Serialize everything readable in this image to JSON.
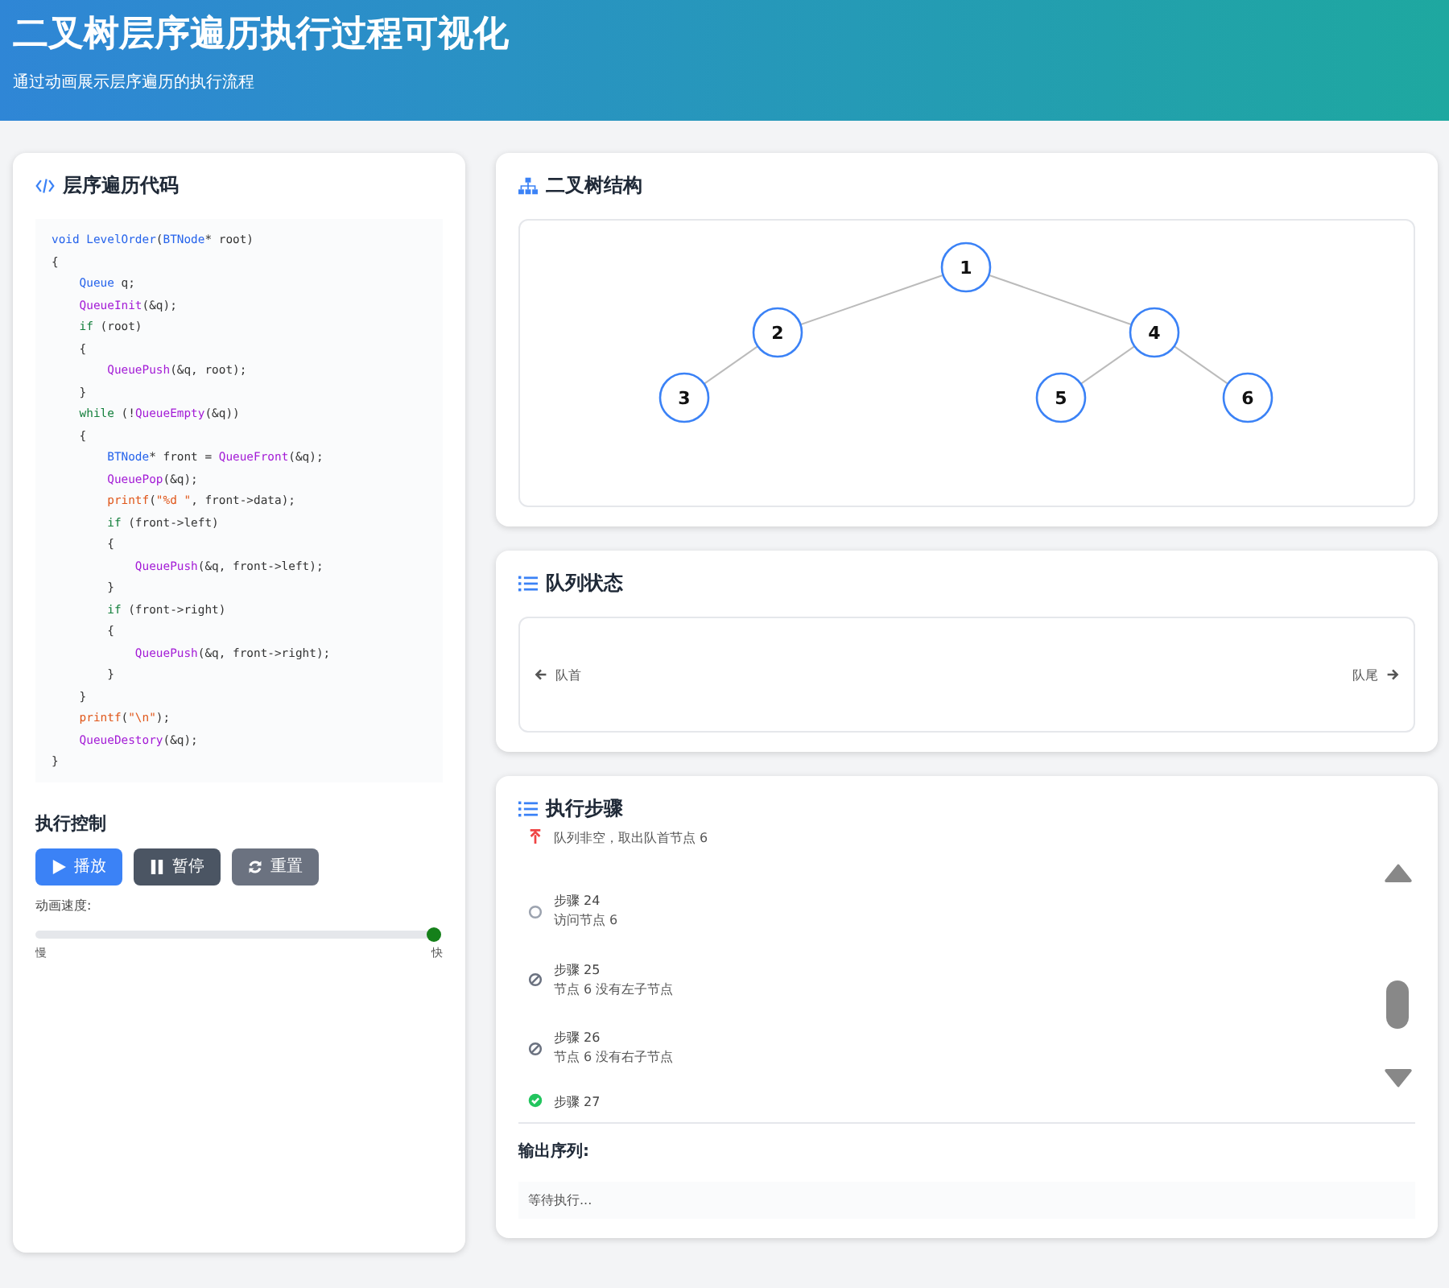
{
  "header": {
    "title": "二叉树层序遍历执行过程可视化",
    "subtitle": "通过动画展示层序遍历的执行流程"
  },
  "code_panel": {
    "title": "层序遍历代码",
    "lines": [
      [
        {
          "kind": "type",
          "text": "void "
        },
        {
          "kind": "type",
          "text": "LevelOrder"
        },
        {
          "kind": "plain",
          "text": "("
        },
        {
          "kind": "type",
          "text": "BTNode"
        },
        {
          "kind": "plain",
          "text": "* root)"
        }
      ],
      [
        {
          "kind": "plain",
          "text": "{"
        }
      ],
      [
        {
          "kind": "type",
          "text": "    Queue"
        },
        {
          "kind": "plain",
          "text": " q;"
        }
      ],
      [
        {
          "kind": "func",
          "text": "    QueueInit"
        },
        {
          "kind": "plain",
          "text": "(&q);"
        }
      ],
      [
        {
          "kind": "keyword",
          "text": "    if"
        },
        {
          "kind": "plain",
          "text": " (root)"
        }
      ],
      [
        {
          "kind": "plain",
          "text": "    {"
        }
      ],
      [
        {
          "kind": "func",
          "text": "        QueuePush"
        },
        {
          "kind": "plain",
          "text": "(&q, root);"
        }
      ],
      [
        {
          "kind": "plain",
          "text": "    }"
        }
      ],
      [
        {
          "kind": "keyword",
          "text": "    while"
        },
        {
          "kind": "plain",
          "text": " (!"
        },
        {
          "kind": "func",
          "text": "QueueEmpty"
        },
        {
          "kind": "plain",
          "text": "(&q))"
        }
      ],
      [
        {
          "kind": "plain",
          "text": "    {"
        }
      ],
      [
        {
          "kind": "type",
          "text": "        BTNode"
        },
        {
          "kind": "plain",
          "text": "* front = "
        },
        {
          "kind": "func",
          "text": "QueueFront"
        },
        {
          "kind": "plain",
          "text": "(&q);"
        }
      ],
      [
        {
          "kind": "func",
          "text": "        QueuePop"
        },
        {
          "kind": "plain",
          "text": "(&q);"
        }
      ],
      [
        {
          "kind": "io",
          "text": "        printf"
        },
        {
          "kind": "plain",
          "text": "("
        },
        {
          "kind": "io",
          "text": "\"%d \""
        },
        {
          "kind": "plain",
          "text": ", front->data);"
        }
      ],
      [
        {
          "kind": "keyword",
          "text": "        if"
        },
        {
          "kind": "plain",
          "text": " (front->left)"
        }
      ],
      [
        {
          "kind": "plain",
          "text": "        {"
        }
      ],
      [
        {
          "kind": "func",
          "text": "            QueuePush"
        },
        {
          "kind": "plain",
          "text": "(&q, front->left);"
        }
      ],
      [
        {
          "kind": "plain",
          "text": "        }"
        }
      ],
      [
        {
          "kind": "keyword",
          "text": "        if"
        },
        {
          "kind": "plain",
          "text": " (front->right)"
        }
      ],
      [
        {
          "kind": "plain",
          "text": "        {"
        }
      ],
      [
        {
          "kind": "func",
          "text": "            QueuePush"
        },
        {
          "kind": "plain",
          "text": "(&q, front->right);"
        }
      ],
      [
        {
          "kind": "plain",
          "text": "        }"
        }
      ],
      [
        {
          "kind": "plain",
          "text": "    }"
        }
      ],
      [
        {
          "kind": "io",
          "text": "    printf"
        },
        {
          "kind": "plain",
          "text": "("
        },
        {
          "kind": "io",
          "text": "\"\\n\""
        },
        {
          "kind": "plain",
          "text": ");"
        }
      ],
      [
        {
          "kind": "func",
          "text": "    QueueDestory"
        },
        {
          "kind": "plain",
          "text": "(&q);"
        }
      ],
      [
        {
          "kind": "plain",
          "text": "}"
        }
      ]
    ]
  },
  "controls": {
    "title": "执行控制",
    "buttons": [
      {
        "kind": "play",
        "label": "播放"
      },
      {
        "kind": "pause",
        "label": "暂停"
      },
      {
        "kind": "reset",
        "label": "重置"
      }
    ],
    "speed_label": "动画速度:",
    "speed": {
      "level": 1.0,
      "min_label": "慢",
      "max_label": "快"
    }
  },
  "tree_panel": {
    "title": "二叉树结构",
    "root": {
      "label": "1",
      "children": [
        {
          "label": "2",
          "kind": "left_child",
          "children": [
            {
              "label": "3",
              "kind": "left_child"
            }
          ]
        },
        {
          "label": "4",
          "kind": "right_child",
          "children": [
            {
              "label": "5",
              "kind": "left_child"
            },
            {
              "label": "6",
              "kind": "right_child"
            }
          ]
        }
      ]
    }
  },
  "queue_panel": {
    "title": "队列状态",
    "front_label": "队首",
    "rear_label": "队尾"
  },
  "steps_panel": {
    "title": "执行步骤",
    "steps": [
      {
        "kind": "dequeue",
        "description": "队列非空，取出队首节点 6"
      },
      {
        "kind": "visit",
        "title": "步骤 24",
        "description": "访问节点 6"
      },
      {
        "kind": "none",
        "title": "步骤 25",
        "description": "节点 6 没有左子节点"
      },
      {
        "kind": "none",
        "title": "步骤 26",
        "description": "节点 6 没有右子节点"
      },
      {
        "kind": "done",
        "title": "步骤 27"
      }
    ],
    "output_title": "输出序列:",
    "output_value": "等待执行..."
  }
}
